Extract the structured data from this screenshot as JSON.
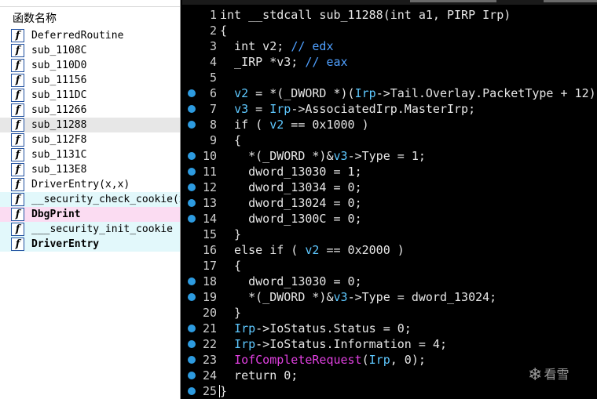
{
  "function_list": {
    "header": "函数名称",
    "items": [
      {
        "name": "DeferredRoutine",
        "style": ""
      },
      {
        "name": "sub_1108C",
        "style": ""
      },
      {
        "name": "sub_110D0",
        "style": ""
      },
      {
        "name": "sub_11156",
        "style": ""
      },
      {
        "name": "sub_111DC",
        "style": ""
      },
      {
        "name": "sub_11266",
        "style": ""
      },
      {
        "name": "sub_11288",
        "style": "sel"
      },
      {
        "name": "sub_112F8",
        "style": ""
      },
      {
        "name": "sub_1131C",
        "style": ""
      },
      {
        "name": "sub_113E8",
        "style": ""
      },
      {
        "name": "DriverEntry(x,x)",
        "style": ""
      },
      {
        "name": "__security_check_cookie(x)",
        "style": "lib"
      },
      {
        "name": "DbgPrint",
        "style": "import bold"
      },
      {
        "name": "___security_init_cookie",
        "style": "lib"
      },
      {
        "name": "DriverEntry",
        "style": "lib bold"
      }
    ],
    "icon_glyph": "f"
  },
  "pseudocode": {
    "lines": [
      {
        "n": "1",
        "bp": false,
        "tokens": [
          [
            "int __stdcall sub_11288(int a1, PIRP Irp)",
            "default"
          ]
        ]
      },
      {
        "n": "2",
        "bp": false,
        "tokens": [
          [
            "{",
            "default"
          ]
        ]
      },
      {
        "n": "3",
        "bp": false,
        "tokens": [
          [
            "  int v2; ",
            "default"
          ],
          [
            "// edx",
            "blue"
          ]
        ]
      },
      {
        "n": "4",
        "bp": false,
        "tokens": [
          [
            "  _IRP *v3; ",
            "default"
          ],
          [
            "// eax",
            "blue"
          ]
        ]
      },
      {
        "n": "5",
        "bp": false,
        "tokens": []
      },
      {
        "n": "6",
        "bp": true,
        "tokens": [
          [
            "  ",
            "default"
          ],
          [
            "v2",
            "cyan"
          ],
          [
            " = *(_DWORD *)(",
            "default"
          ],
          [
            "Irp",
            "cyan"
          ],
          [
            "->Tail.Overlay.PacketType + 12);",
            "default"
          ]
        ]
      },
      {
        "n": "7",
        "bp": true,
        "tokens": [
          [
            "  ",
            "default"
          ],
          [
            "v3",
            "cyan"
          ],
          [
            " = ",
            "default"
          ],
          [
            "Irp",
            "cyan"
          ],
          [
            "->AssociatedIrp.MasterIrp;",
            "default"
          ]
        ]
      },
      {
        "n": "8",
        "bp": true,
        "tokens": [
          [
            "  if ( ",
            "default"
          ],
          [
            "v2",
            "cyan"
          ],
          [
            " == 0x1000 )",
            "default"
          ]
        ]
      },
      {
        "n": "9",
        "bp": false,
        "tokens": [
          [
            "  {",
            "default"
          ]
        ]
      },
      {
        "n": "10",
        "bp": true,
        "tokens": [
          [
            "    *(_DWORD *)&",
            "default"
          ],
          [
            "v3",
            "cyan"
          ],
          [
            "->Type = 1;",
            "default"
          ]
        ]
      },
      {
        "n": "11",
        "bp": true,
        "tokens": [
          [
            "    dword_13030 = 1;",
            "default"
          ]
        ]
      },
      {
        "n": "12",
        "bp": true,
        "tokens": [
          [
            "    dword_13034 = 0;",
            "default"
          ]
        ]
      },
      {
        "n": "13",
        "bp": true,
        "tokens": [
          [
            "    dword_13024 = 0;",
            "default"
          ]
        ]
      },
      {
        "n": "14",
        "bp": true,
        "tokens": [
          [
            "    dword_1300C = 0;",
            "default"
          ]
        ]
      },
      {
        "n": "15",
        "bp": false,
        "tokens": [
          [
            "  }",
            "default"
          ]
        ]
      },
      {
        "n": "16",
        "bp": false,
        "tokens": [
          [
            "  else if ( ",
            "default"
          ],
          [
            "v2",
            "cyan"
          ],
          [
            " == 0x2000 )",
            "default"
          ]
        ]
      },
      {
        "n": "17",
        "bp": false,
        "tokens": [
          [
            "  {",
            "default"
          ]
        ]
      },
      {
        "n": "18",
        "bp": true,
        "tokens": [
          [
            "    dword_13030 = 0;",
            "default"
          ]
        ]
      },
      {
        "n": "19",
        "bp": true,
        "tokens": [
          [
            "    *(_DWORD *)&",
            "default"
          ],
          [
            "v3",
            "cyan"
          ],
          [
            "->Type = dword_13024;",
            "default"
          ]
        ]
      },
      {
        "n": "20",
        "bp": false,
        "tokens": [
          [
            "  }",
            "default"
          ]
        ]
      },
      {
        "n": "21",
        "bp": true,
        "tokens": [
          [
            "  ",
            "default"
          ],
          [
            "Irp",
            "cyan"
          ],
          [
            "->IoStatus.Status = 0;",
            "default"
          ]
        ]
      },
      {
        "n": "22",
        "bp": true,
        "tokens": [
          [
            "  ",
            "default"
          ],
          [
            "Irp",
            "cyan"
          ],
          [
            "->IoStatus.Information = 4;",
            "default"
          ]
        ]
      },
      {
        "n": "23",
        "bp": true,
        "tokens": [
          [
            "  ",
            "default"
          ],
          [
            "IofCompleteRequest",
            "magenta"
          ],
          [
            "(",
            "default"
          ],
          [
            "Irp",
            "cyan"
          ],
          [
            ", 0);",
            "default"
          ]
        ]
      },
      {
        "n": "24",
        "bp": true,
        "tokens": [
          [
            "  return 0;",
            "default"
          ]
        ]
      },
      {
        "n": "25",
        "bp": true,
        "tokens": [
          [
            "}",
            "default"
          ]
        ]
      }
    ]
  },
  "watermark": {
    "icon": "snowflake-icon",
    "glyph": "❄",
    "text": "看雪"
  },
  "colors": {
    "breakpoint": "#2d9be0",
    "library_row": "#e2f8fb",
    "import_row": "#fbdcf2",
    "selected_row": "#e7e7e7"
  }
}
